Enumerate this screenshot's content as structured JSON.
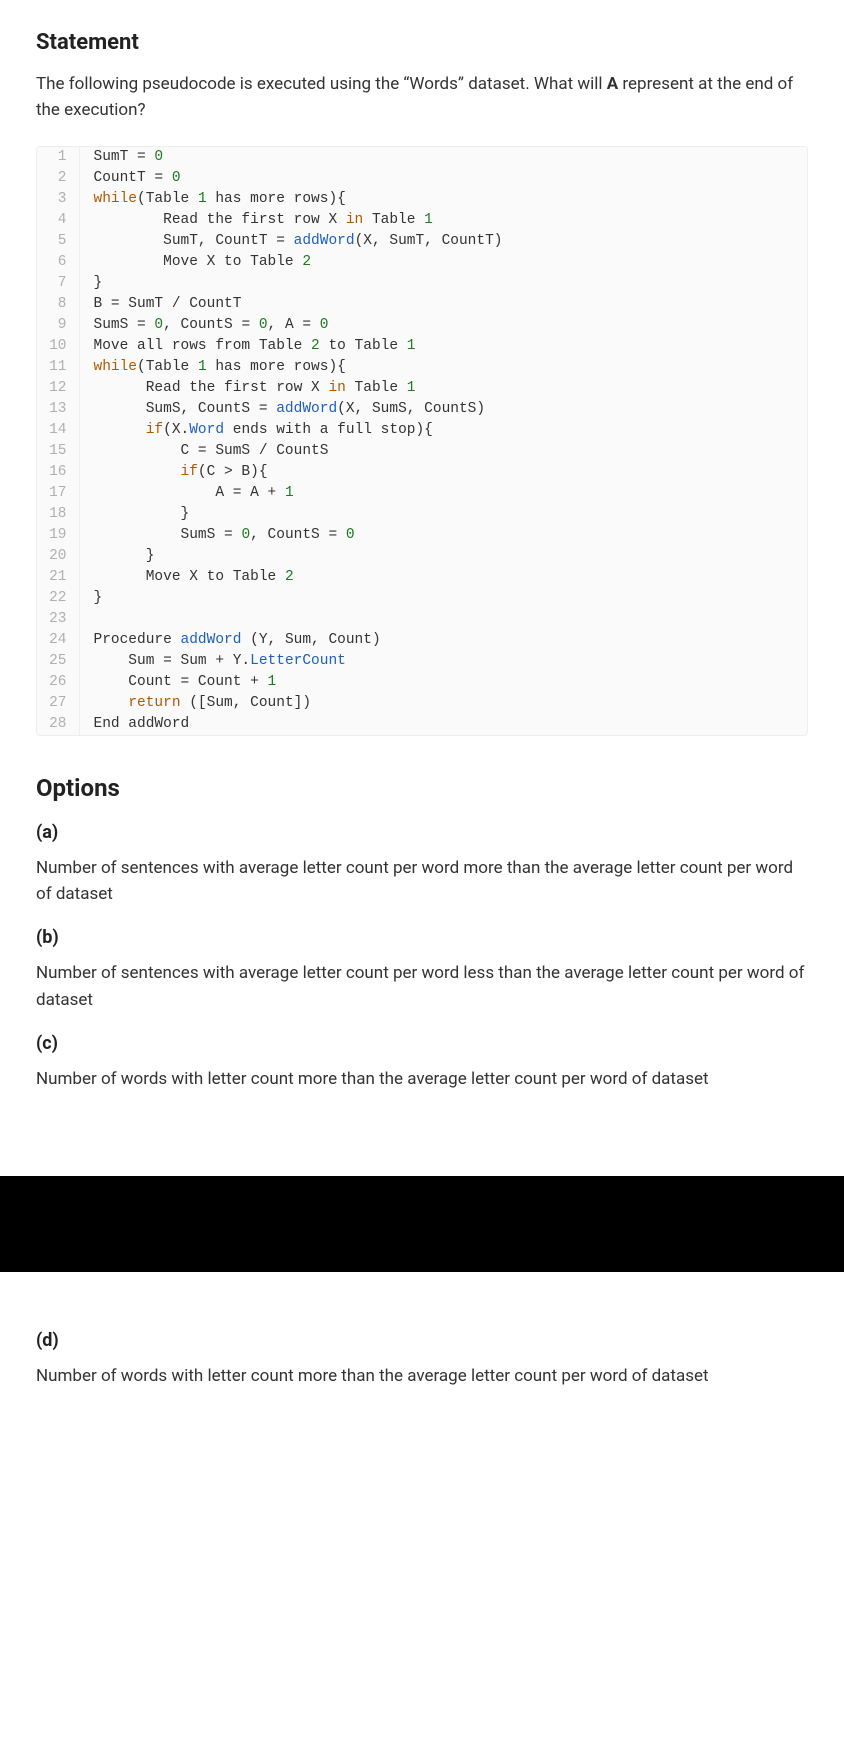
{
  "statement_heading": "Statement",
  "question_prefix": "The following pseudocode is executed using the “Words” dataset. What will ",
  "question_bold": "A",
  "question_suffix": " represent at the end of the execution?",
  "code": [
    {
      "n": "1",
      "raw": "SumT = 0",
      "tokens": [
        [
          "",
          "SumT = "
        ],
        [
          "num",
          "0"
        ]
      ]
    },
    {
      "n": "2",
      "raw": "CountT = 0",
      "tokens": [
        [
          "",
          "CountT = "
        ],
        [
          "num",
          "0"
        ]
      ]
    },
    {
      "n": "3",
      "raw": "while(Table 1 has more rows){",
      "tokens": [
        [
          "kw",
          "while"
        ],
        [
          "",
          "(Table "
        ],
        [
          "num",
          "1"
        ],
        [
          "",
          " has more rows){"
        ]
      ]
    },
    {
      "n": "4",
      "raw": "        Read the first row X in Table 1",
      "tokens": [
        [
          "",
          "        Read the first row X "
        ],
        [
          "kw",
          "in"
        ],
        [
          "",
          " Table "
        ],
        [
          "num",
          "1"
        ]
      ]
    },
    {
      "n": "5",
      "raw": "        SumT, CountT = addWord(X, SumT, CountT)",
      "tokens": [
        [
          "",
          "        SumT, CountT = "
        ],
        [
          "fn",
          "addWord"
        ],
        [
          "",
          "(X, SumT, CountT)"
        ]
      ]
    },
    {
      "n": "6",
      "raw": "        Move X to Table 2",
      "tokens": [
        [
          "",
          "        Move X to Table "
        ],
        [
          "num",
          "2"
        ]
      ]
    },
    {
      "n": "7",
      "raw": "}",
      "tokens": [
        [
          "",
          "}"
        ]
      ]
    },
    {
      "n": "8",
      "raw": "B = SumT / CountT",
      "tokens": [
        [
          "",
          "B = SumT / CountT"
        ]
      ]
    },
    {
      "n": "9",
      "raw": "SumS = 0, CountS = 0, A = 0",
      "tokens": [
        [
          "",
          "SumS = "
        ],
        [
          "num",
          "0"
        ],
        [
          "",
          ", CountS = "
        ],
        [
          "num",
          "0"
        ],
        [
          "",
          ", A = "
        ],
        [
          "num",
          "0"
        ]
      ]
    },
    {
      "n": "10",
      "raw": "Move all rows from Table 2 to Table 1",
      "tokens": [
        [
          "",
          "Move all rows from Table "
        ],
        [
          "num",
          "2"
        ],
        [
          "",
          " to Table "
        ],
        [
          "num",
          "1"
        ]
      ]
    },
    {
      "n": "11",
      "raw": "while(Table 1 has more rows){",
      "tokens": [
        [
          "kw",
          "while"
        ],
        [
          "",
          "(Table "
        ],
        [
          "num",
          "1"
        ],
        [
          "",
          " has more rows){"
        ]
      ]
    },
    {
      "n": "12",
      "raw": "      Read the first row X in Table 1",
      "tokens": [
        [
          "",
          "      Read the first row X "
        ],
        [
          "kw",
          "in"
        ],
        [
          "",
          " Table "
        ],
        [
          "num",
          "1"
        ]
      ]
    },
    {
      "n": "13",
      "raw": "      SumS, CountS = addWord(X, SumS, CountS)",
      "tokens": [
        [
          "",
          "      SumS, CountS = "
        ],
        [
          "fn",
          "addWord"
        ],
        [
          "",
          "(X, SumS, CountS)"
        ]
      ]
    },
    {
      "n": "14",
      "raw": "      if(X.Word ends with a full stop){",
      "tokens": [
        [
          "",
          "      "
        ],
        [
          "kw",
          "if"
        ],
        [
          "",
          "(X."
        ],
        [
          "prop",
          "Word"
        ],
        [
          "",
          " ends with a full stop){"
        ]
      ]
    },
    {
      "n": "15",
      "raw": "          C = SumS / CountS",
      "tokens": [
        [
          "",
          "          C = SumS / CountS"
        ]
      ]
    },
    {
      "n": "16",
      "raw": "          if(C > B){",
      "tokens": [
        [
          "",
          "          "
        ],
        [
          "kw",
          "if"
        ],
        [
          "",
          "(C > B){"
        ]
      ]
    },
    {
      "n": "17",
      "raw": "              A = A + 1",
      "tokens": [
        [
          "",
          "              A = A + "
        ],
        [
          "num",
          "1"
        ]
      ]
    },
    {
      "n": "18",
      "raw": "          }",
      "tokens": [
        [
          "",
          "          }"
        ]
      ]
    },
    {
      "n": "19",
      "raw": "          SumS = 0, CountS = 0",
      "tokens": [
        [
          "",
          "          SumS = "
        ],
        [
          "num",
          "0"
        ],
        [
          "",
          ", CountS = "
        ],
        [
          "num",
          "0"
        ]
      ]
    },
    {
      "n": "20",
      "raw": "      }",
      "tokens": [
        [
          "",
          "      }"
        ]
      ]
    },
    {
      "n": "21",
      "raw": "      Move X to Table 2",
      "tokens": [
        [
          "",
          "      Move X to Table "
        ],
        [
          "num",
          "2"
        ]
      ]
    },
    {
      "n": "22",
      "raw": "}",
      "tokens": [
        [
          "",
          "}"
        ]
      ]
    },
    {
      "n": "23",
      "raw": "",
      "tokens": [
        [
          "",
          ""
        ]
      ]
    },
    {
      "n": "24",
      "raw": "Procedure addWord (Y, Sum, Count)",
      "tokens": [
        [
          "",
          "Procedure "
        ],
        [
          "fn",
          "addWord"
        ],
        [
          "",
          " (Y, Sum, Count)"
        ]
      ]
    },
    {
      "n": "25",
      "raw": "    Sum = Sum + Y.LetterCount",
      "tokens": [
        [
          "",
          "    Sum = Sum + Y."
        ],
        [
          "prop",
          "LetterCount"
        ]
      ]
    },
    {
      "n": "26",
      "raw": "    Count = Count + 1",
      "tokens": [
        [
          "",
          "    Count = Count + "
        ],
        [
          "num",
          "1"
        ]
      ]
    },
    {
      "n": "27",
      "raw": "    return ([Sum, Count])",
      "tokens": [
        [
          "",
          "    "
        ],
        [
          "kw",
          "return"
        ],
        [
          "",
          " ([Sum, Count])"
        ]
      ]
    },
    {
      "n": "28",
      "raw": "End addWord",
      "tokens": [
        [
          "",
          "End addWord"
        ]
      ]
    }
  ],
  "options_heading": "Options",
  "options": [
    {
      "label": "(a)",
      "text": "Number of sentences with average letter count per word more than the average letter count per word of dataset"
    },
    {
      "label": "(b)",
      "text": "Number of sentences with average letter count per word less than the average letter count per word of dataset"
    },
    {
      "label": "(c)",
      "text": "Number of words with letter count more than the average letter count per word of dataset"
    },
    {
      "label": "(d)",
      "text": "Number of words with letter count more than the average letter count per word of dataset"
    }
  ]
}
